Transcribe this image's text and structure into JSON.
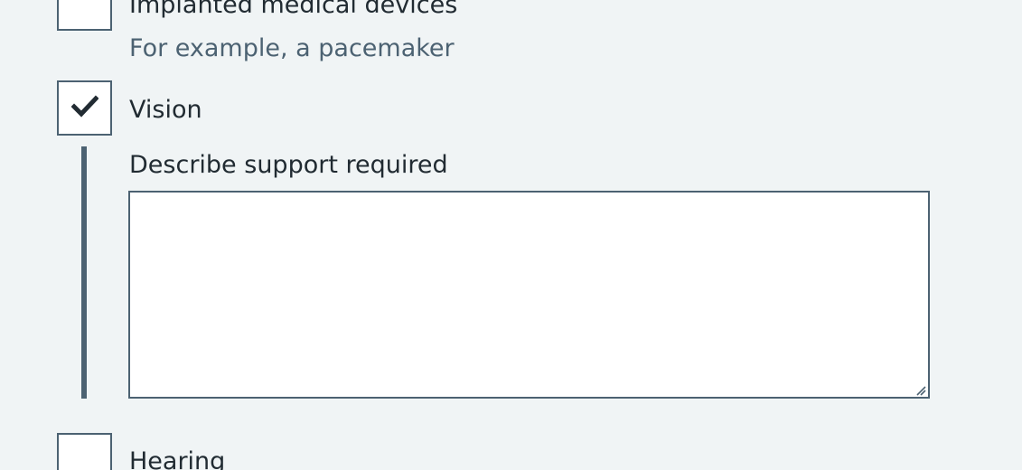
{
  "options": [
    {
      "label": "Implanted medical devices",
      "hint": "For example, a pacemaker",
      "checked": false,
      "icon": "empty-checkbox"
    },
    {
      "label": "Vision",
      "checked": true,
      "icon": "checkmark-icon",
      "conditional": {
        "label": "Describe support required",
        "value": ""
      }
    },
    {
      "label": "Hearing",
      "checked": false,
      "icon": "empty-checkbox"
    }
  ],
  "colors": {
    "background": "#f0f4f5",
    "border": "#4c6272",
    "text": "#212b32",
    "hint": "#4c6272",
    "field": "#ffffff"
  }
}
